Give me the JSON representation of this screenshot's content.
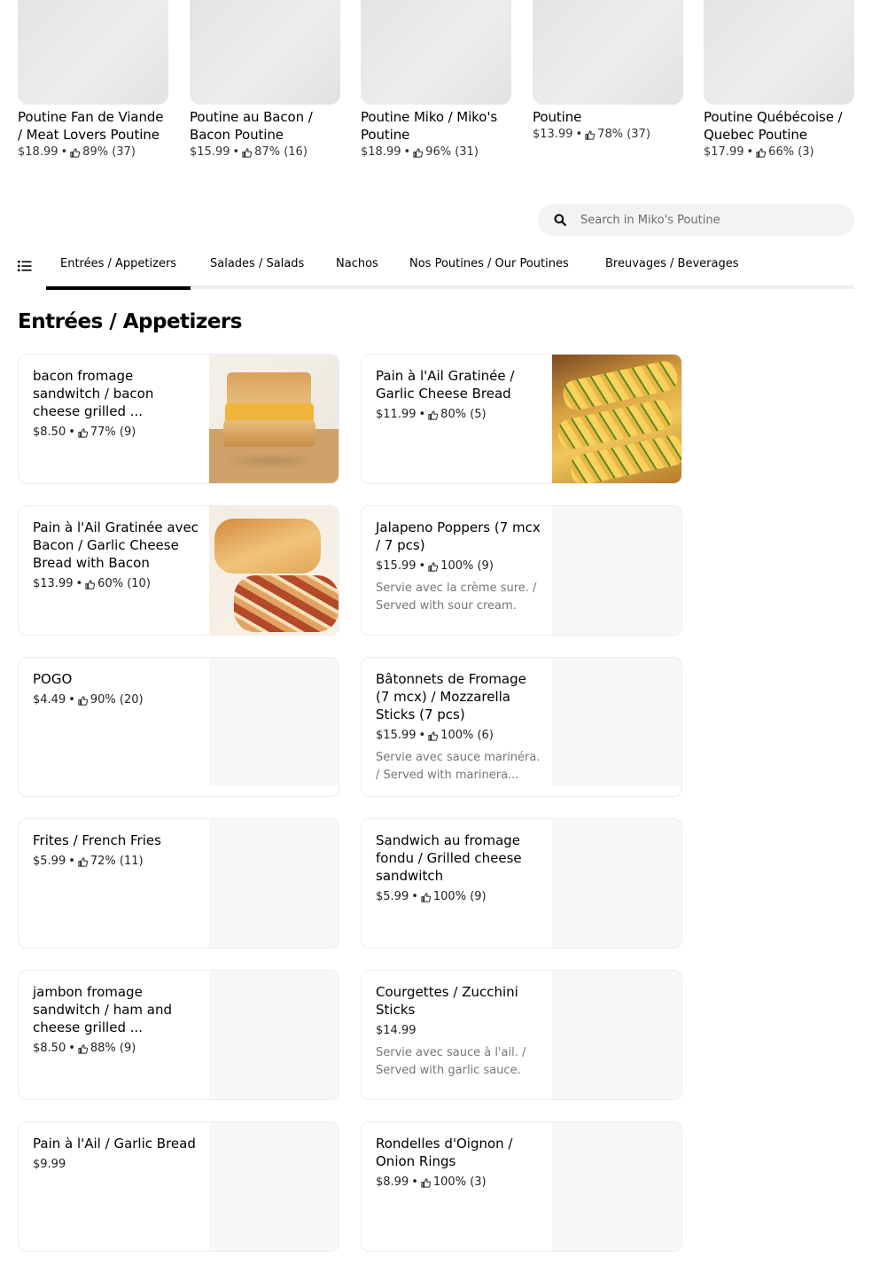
{
  "popular": [
    {
      "title": "Poutine Fan de Viande / Meat Lovers Poutine",
      "price": "$18.99",
      "rating": "89% (37)"
    },
    {
      "title": "Poutine au Bacon / Bacon Poutine",
      "price": "$15.99",
      "rating": "87% (16)"
    },
    {
      "title": "Poutine Miko / Miko's Poutine",
      "price": "$18.99",
      "rating": "96% (31)"
    },
    {
      "title": "Poutine",
      "price": "$13.99",
      "rating": "78% (37)"
    },
    {
      "title": "Poutine Québécoise / Quebec Poutine",
      "price": "$17.99",
      "rating": "66% (3)"
    }
  ],
  "search": {
    "placeholder": "Search in Miko's Poutine"
  },
  "tabs": [
    {
      "label": "Entrées / Appetizers",
      "active": true
    },
    {
      "label": "Salades / Salads",
      "active": false
    },
    {
      "label": "Nachos",
      "active": false
    },
    {
      "label": "Nos Poutines / Our Poutines",
      "active": false
    },
    {
      "label": "Breuvages / Beverages",
      "active": false
    }
  ],
  "section": {
    "title": "Entrées / Appetizers"
  },
  "items": [
    {
      "title": "bacon fromage sandwitch / bacon cheese grilled ...",
      "price": "$8.50",
      "rating": "77% (9)",
      "desc": "",
      "photo": "sandwich"
    },
    {
      "title": "Pain à l'Ail Gratinée / Garlic Cheese Bread",
      "price": "$11.99",
      "rating": "80% (5)",
      "desc": "",
      "photo": "garlic"
    },
    {
      "title": "Pain à l'Ail Gratinée avec Bacon / Garlic Cheese Bread with Bacon",
      "price": "$13.99",
      "rating": "60% (10)",
      "desc": "",
      "photo": "bacon"
    },
    {
      "title": "Jalapeno Poppers (7 mcx / 7 pcs)",
      "price": "$15.99",
      "rating": "100% (9)",
      "desc": "Servie avec la crème sure. / Served with sour cream.",
      "photo": ""
    },
    {
      "title": "POGO",
      "price": "$4.49",
      "rating": "90% (20)",
      "desc": "",
      "photo": ""
    },
    {
      "title": "Bâtonnets de Fromage (7 mcx) / Mozzarella Sticks (7 pcs)",
      "price": "$15.99",
      "rating": "100% (6)",
      "desc": "Servie avec sauce marinéra. / Served with marinera...",
      "photo": ""
    },
    {
      "title": "Frites / French Fries",
      "price": "$5.99",
      "rating": "72% (11)",
      "desc": "",
      "photo": ""
    },
    {
      "title": "Sandwich au fromage fondu / Grilled cheese sandwitch",
      "price": "$5.99",
      "rating": "100% (9)",
      "desc": "",
      "photo": ""
    },
    {
      "title": "jambon fromage sandwitch / ham and cheese grilled ...",
      "price": "$8.50",
      "rating": "88% (9)",
      "desc": "",
      "photo": ""
    },
    {
      "title": "Courgettes / Zucchini Sticks",
      "price": "$14.99",
      "rating": "",
      "desc": "Servie avec sauce à l'ail. / Served with garlic sauce.",
      "photo": ""
    },
    {
      "title": "Pain à l'Ail / Garlic Bread",
      "price": "$9.99",
      "rating": "",
      "desc": "",
      "photo": ""
    },
    {
      "title": "Rondelles d'Oignon / Onion Rings",
      "price": "$8.99",
      "rating": "100% (3)",
      "desc": "",
      "photo": ""
    }
  ],
  "icons": {
    "thumb": "thumbs-up-icon",
    "search": "search-icon",
    "menu": "list-menu-icon"
  },
  "colors": {
    "active_tab": "#000000",
    "muted_text": "#757575"
  }
}
